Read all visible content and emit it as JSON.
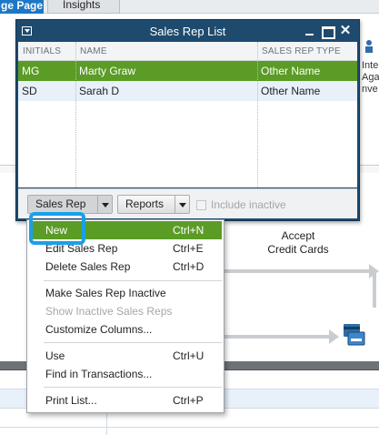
{
  "background": {
    "tabs": [
      {
        "label": "ge Page",
        "active": true
      },
      {
        "label": "Insights",
        "active": false
      }
    ],
    "right_edge_lines": [
      "Inte",
      "Aga",
      "nve"
    ],
    "flow_label": [
      "Accept",
      "Credit Cards"
    ]
  },
  "window": {
    "title": "Sales Rep List",
    "columns": [
      "INITIALS",
      "NAME",
      "SALES REP TYPE"
    ],
    "rows": [
      {
        "initials": "MG",
        "name": "Marty Graw",
        "type": "Other Name",
        "selected": true
      },
      {
        "initials": "SD",
        "name": "Sarah D",
        "type": "Other Name",
        "selected": false
      }
    ],
    "footer": {
      "sales_rep_button": "Sales Rep",
      "reports_button": "Reports",
      "include_inactive_label": "Include inactive",
      "include_inactive_checked": false,
      "include_inactive_enabled": false
    }
  },
  "menu": {
    "items": [
      {
        "label": "New",
        "shortcut": "Ctrl+N",
        "highlighted": true,
        "disabled": false
      },
      {
        "label": "Edit Sales Rep",
        "shortcut": "Ctrl+E",
        "highlighted": false,
        "disabled": false
      },
      {
        "label": "Delete Sales Rep",
        "shortcut": "Ctrl+D",
        "highlighted": false,
        "disabled": false
      },
      {
        "label": "Make Sales Rep Inactive",
        "shortcut": "",
        "highlighted": false,
        "disabled": false
      },
      {
        "label": "Show Inactive Sales Reps",
        "shortcut": "",
        "highlighted": false,
        "disabled": true
      },
      {
        "label": "Customize Columns...",
        "shortcut": "",
        "highlighted": false,
        "disabled": false
      },
      {
        "label": "Use",
        "shortcut": "Ctrl+U",
        "highlighted": false,
        "disabled": false
      },
      {
        "label": "Find in Transactions...",
        "shortcut": "",
        "highlighted": false,
        "disabled": false
      },
      {
        "label": "Print List...",
        "shortcut": "Ctrl+P",
        "highlighted": false,
        "disabled": false
      }
    ]
  },
  "colors": {
    "title_bar": "#1e4a6e",
    "selection": "#5a9c25",
    "callout": "#1aa0e8",
    "active_tab": "#1c78c7"
  },
  "icons": [
    "menu-box-icon",
    "minimize-icon",
    "maximize-icon",
    "close-icon",
    "dropdown-arrow-icon",
    "credit-card-icon",
    "flow-arrow-icon"
  ]
}
